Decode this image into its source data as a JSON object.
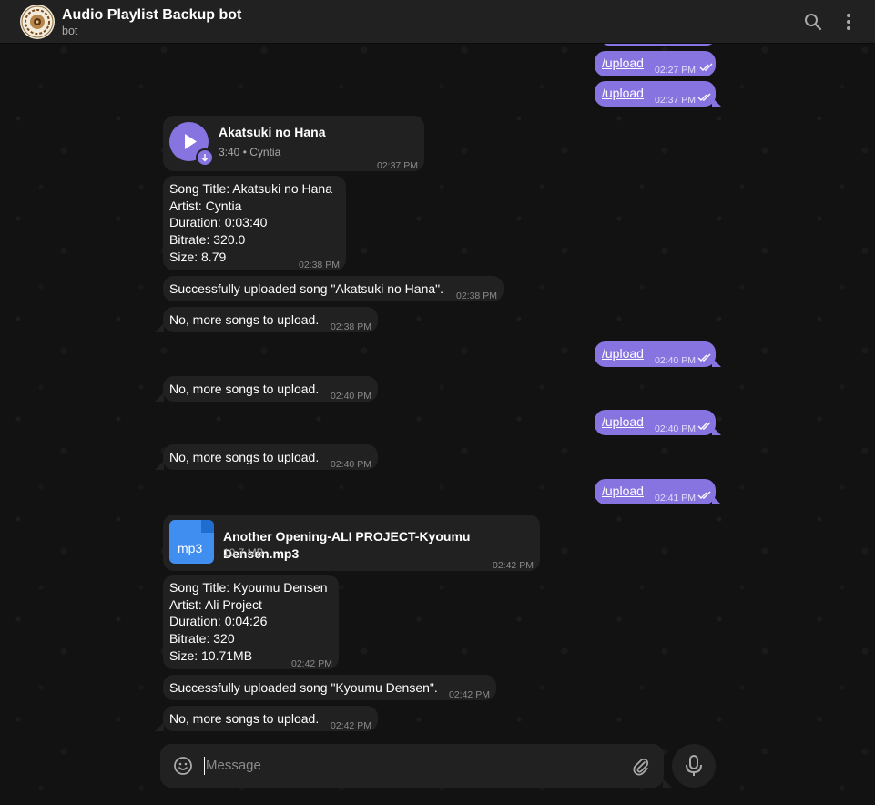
{
  "header": {
    "title": "Audio Playlist Backup bot",
    "subtitle": "bot",
    "search_icon": "search-icon",
    "menu_icon": "more-vertical-icon"
  },
  "messages": {
    "out1": {
      "text": "/upload",
      "time": "02:27 PM"
    },
    "out2": {
      "text": "/upload",
      "time": "02:37 PM"
    },
    "audio": {
      "title": "Akatsuki no Hana",
      "duration": "3:40",
      "performer": "Cyntia",
      "time": "02:37 PM"
    },
    "info1": {
      "lines": [
        "Song Title: Akatsuki no Hana",
        "Artist: Cyntia",
        "Duration: 0:03:40",
        "Bitrate: 320.0",
        "Size: 8.79"
      ],
      "time": "02:38 PM"
    },
    "ok1": {
      "text": "Successfully uploaded song \"Akatsuki no Hana\".",
      "time": "02:38 PM"
    },
    "none1": {
      "text": "No, more songs to upload.",
      "time": "02:38 PM"
    },
    "out3": {
      "text": "/upload",
      "time": "02:40 PM"
    },
    "none2": {
      "text": "No, more songs to upload.",
      "time": "02:40 PM"
    },
    "out4": {
      "text": "/upload",
      "time": "02:40 PM"
    },
    "none3": {
      "text": "No, more songs to upload.",
      "time": "02:40 PM"
    },
    "out5": {
      "text": "/upload",
      "time": "02:41 PM"
    },
    "file": {
      "ext": "mp3",
      "name": "Another Opening-ALI PROJECT-Kyoumu Densen.mp3",
      "size": "10.7 MB",
      "time": "02:42 PM"
    },
    "info2": {
      "lines": [
        "Song Title: Kyoumu Densen",
        "Artist: Ali Project",
        "Duration: 0:04:26",
        "Bitrate: 320",
        "Size: 10.71MB"
      ],
      "time": "02:42 PM"
    },
    "ok2": {
      "text": "Successfully uploaded song \"Kyoumu Densen\".",
      "time": "02:42 PM"
    },
    "none4": {
      "text": "No, more songs to upload.",
      "time": "02:42 PM"
    }
  },
  "composer": {
    "placeholder": "Message",
    "emoji_icon": "smile-icon",
    "attach_icon": "paperclip-icon",
    "mic_icon": "microphone-icon"
  },
  "colors": {
    "outgoing_bubble": "#8774e1",
    "incoming_bubble": "#212121",
    "header_bg": "#212121",
    "audio_play": "#8774e1",
    "file_icon": "#3f8ef0"
  }
}
